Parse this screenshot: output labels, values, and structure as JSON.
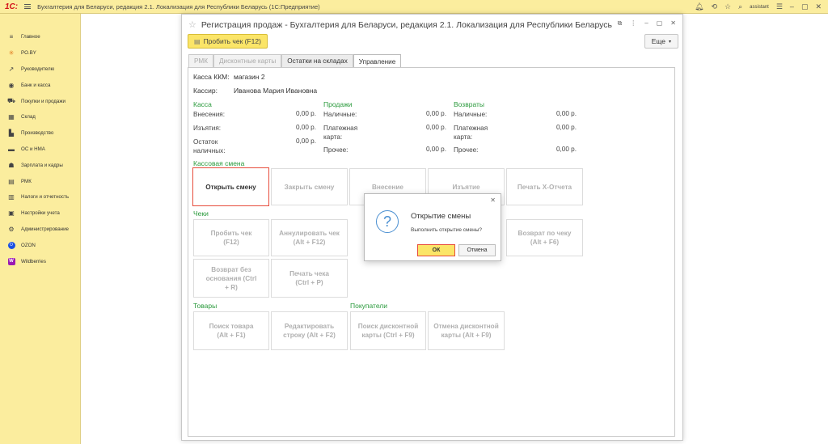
{
  "topbar": {
    "logo": "1С:",
    "title": "Бухгалтерия для Беларуси, редакция 2.1. Локализация для Республики Беларусь   (1С:Предприятие)",
    "user": "assistant"
  },
  "sidebar": {
    "items": [
      {
        "label": "Главное",
        "icon": "menu-icon"
      },
      {
        "label": "PO.BY",
        "icon": "sun-icon"
      },
      {
        "label": "Руководителю",
        "icon": "trend-icon"
      },
      {
        "label": "Банк и касса",
        "icon": "bank-icon"
      },
      {
        "label": "Покупки и продажи",
        "icon": "cart-icon"
      },
      {
        "label": "Склад",
        "icon": "warehouse-icon"
      },
      {
        "label": "Производство",
        "icon": "factory-icon"
      },
      {
        "label": "ОС и НМА",
        "icon": "truck-icon"
      },
      {
        "label": "Зарплата и кадры",
        "icon": "people-icon"
      },
      {
        "label": "РМК",
        "icon": "register-icon"
      },
      {
        "label": "Налоги и отчетность",
        "icon": "report-icon"
      },
      {
        "label": "Настройки учета",
        "icon": "settings-icon"
      },
      {
        "label": "Администрирование",
        "icon": "gear-icon"
      },
      {
        "label": "OZON",
        "icon": "ozon-icon"
      },
      {
        "label": "Wildberries",
        "icon": "wildberries-icon"
      }
    ]
  },
  "window": {
    "title": "Регистрация продаж - Бухгалтерия для Беларуси, редакция 2.1. Локализация для Республики Беларусь",
    "main_button": "Пробить чек (F12)",
    "more_button": "Еще",
    "tabs": [
      "РМК",
      "Дисконтные карты",
      "Остатки на складах",
      "Управление"
    ]
  },
  "info": {
    "kkm_label": "Касса ККМ:",
    "kkm_value": "магазин 2",
    "cashier_label": "Кассир:",
    "cashier_value": "Иванова Мария Ивановна"
  },
  "summary": {
    "kassa": {
      "title": "Касса",
      "rows": [
        {
          "label": "Внесения:",
          "value": "0,00 р."
        },
        {
          "label": "Изъятия:",
          "value": "0,00 р."
        },
        {
          "label": "Остаток наличных:",
          "value": "0,00 р."
        }
      ]
    },
    "sales": {
      "title": "Продажи",
      "rows": [
        {
          "label": "Наличные:",
          "value": "0,00 р."
        },
        {
          "label": "Платежная карта:",
          "value": "0,00 р."
        },
        {
          "label": "Прочее:",
          "value": "0,00 р."
        }
      ]
    },
    "returns": {
      "title": "Возвраты",
      "rows": [
        {
          "label": "Наличные:",
          "value": "0,00 р."
        },
        {
          "label": "Платежная карта:",
          "value": "0,00 р."
        },
        {
          "label": "Прочее:",
          "value": "0,00 р."
        }
      ]
    }
  },
  "shift": {
    "title": "Кассовая смена",
    "buttons": [
      "Открыть смену",
      "Закрыть смену",
      "Внесение",
      "Изъятие",
      "Печать X-Отчета"
    ]
  },
  "checks": {
    "title": "Чеки",
    "buttons": [
      "Пробить чек (F12)",
      "Аннулировать чек (Alt + F12)",
      "Возврат по чеку (Alt + F6)",
      "Возврат без основания (Ctrl + R)",
      "Печать чека (Ctrl + P)"
    ]
  },
  "goods": {
    "title": "Товары",
    "buttons": [
      "Поиск товара (Alt + F1)",
      "Редактировать строку (Alt + F2)"
    ]
  },
  "buyers": {
    "title": "Покупатели",
    "buttons": [
      "Поиск дисконтной карты (Ctrl + F9)",
      "Отмена дисконтной карты (Alt + F9)"
    ]
  },
  "dialog": {
    "title": "Открытие смены",
    "message": "Выполнить открытие смены?",
    "ok": "ОК",
    "cancel": "Отмена"
  },
  "colors": {
    "panel": "#fbed9e",
    "accent_yellow": "#fbe568",
    "section_green": "#2a9a3c",
    "highlight_red": "#e74c3c"
  }
}
